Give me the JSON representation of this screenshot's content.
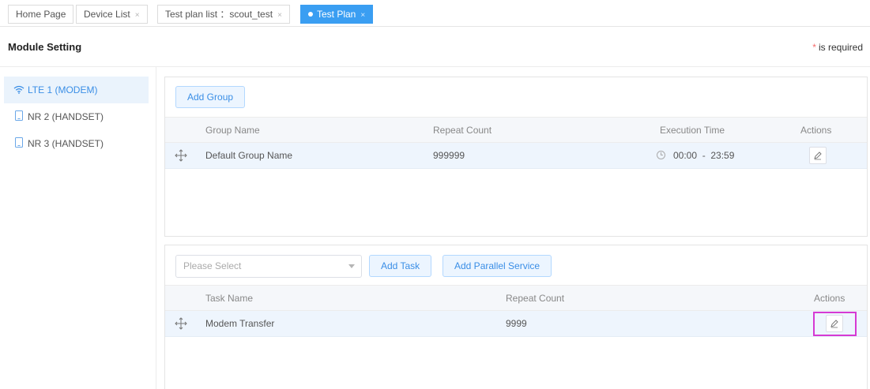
{
  "tabs": [
    {
      "label": "Home Page",
      "closable": false
    },
    {
      "label": "Device List",
      "closable": true
    },
    {
      "label": "Test plan list ：scout_test",
      "closable": true
    },
    {
      "label": "Test Plan",
      "closable": true,
      "active": true
    }
  ],
  "close_glyph": "×",
  "header": {
    "title": "Module Setting",
    "required_star": "*",
    "required_text": "is required"
  },
  "modules": [
    {
      "label": "LTE 1 (MODEM)",
      "icon": "wifi-icon",
      "active": true
    },
    {
      "label": "NR 2 (HANDSET)",
      "icon": "handset-icon"
    },
    {
      "label": "NR 3 (HANDSET)",
      "icon": "handset-icon"
    }
  ],
  "groups": {
    "add_button": "Add Group",
    "columns": {
      "name": "Group Name",
      "repeat": "Repeat Count",
      "time": "Execution Time",
      "actions": "Actions"
    },
    "rows": [
      {
        "name": "Default Group Name",
        "repeat": "999999",
        "time_start": "00:00",
        "time_sep": "-",
        "time_end": "23:59"
      }
    ]
  },
  "tasks": {
    "select_placeholder": "Please Select",
    "add_task_button": "Add Task",
    "add_parallel_button": "Add Parallel Service",
    "columns": {
      "name": "Task Name",
      "repeat": "Repeat Count",
      "actions": "Actions"
    },
    "rows": [
      {
        "name": "Modem Transfer",
        "repeat": "9999"
      }
    ]
  },
  "colors": {
    "accent": "#3a9ef2",
    "highlight": "#d63ad3",
    "required": "#f56c6c"
  }
}
